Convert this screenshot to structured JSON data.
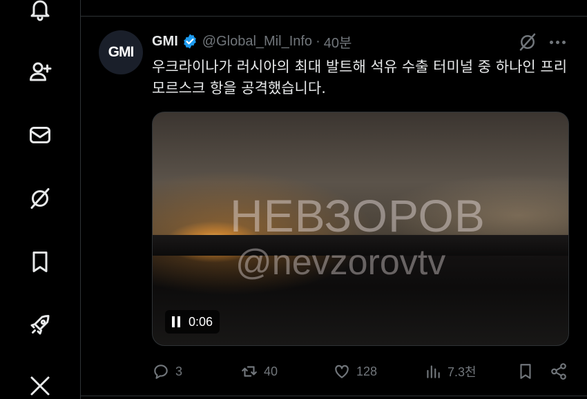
{
  "sidebar": {
    "items": [
      {
        "icon": "bell-icon"
      },
      {
        "icon": "add-user-icon"
      },
      {
        "icon": "mail-icon"
      },
      {
        "icon": "grok-icon"
      },
      {
        "icon": "bookmark-icon"
      },
      {
        "icon": "rocket-icon"
      },
      {
        "icon": "x-logo-icon"
      }
    ]
  },
  "tweet": {
    "avatar_text": "GMI",
    "author_name": "GMI",
    "handle": "@Global_Mil_Info",
    "separator": "·",
    "time": "40분",
    "text": "우크라이나가 러시아의 최대 발트해 석유 수출 터미널 중 하나인 프리모르스크 항을 공격했습니다.",
    "media": {
      "watermark_line1": "НЕВЗОРОВ",
      "watermark_line2": "@nevzorovtv",
      "duration": "0:06"
    },
    "stats": {
      "replies": "3",
      "reposts": "40",
      "likes": "128",
      "views": "7.3천"
    }
  },
  "colors": {
    "background": "#000000",
    "text_primary": "#e7e9ea",
    "text_secondary": "#71767b",
    "border": "#2f3336",
    "verified_blue": "#1d9bf0"
  }
}
